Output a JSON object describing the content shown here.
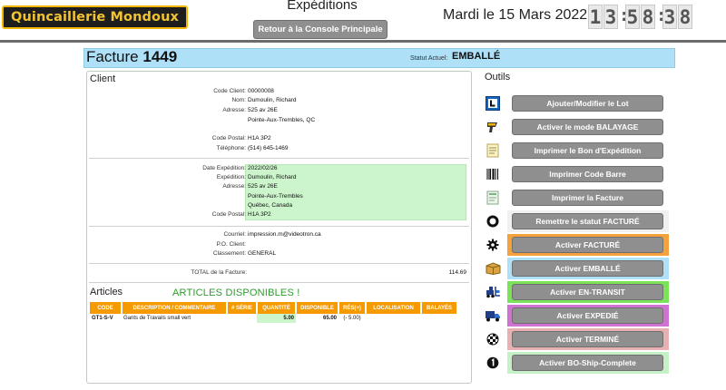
{
  "header": {
    "brand": "Quincaillerie Mondoux",
    "page_title": "Expéditions",
    "console_button": "Retour à la Console Principale",
    "date": "Mardi le 15 Mars 2022",
    "clock": {
      "h1": "1",
      "h2": "3",
      "m1": "5",
      "m2": "8",
      "s1": "3",
      "s2": "8",
      "sep": ":"
    }
  },
  "invoice": {
    "label": "Facture",
    "number": "1449",
    "status_label": "Statut Actuel:",
    "status_value": "EMBALLÉ"
  },
  "client": {
    "section_title": "Client",
    "code_label": "Code Client:",
    "code": "00000008",
    "name_label": "Nom:",
    "name": "Dumoulin, Richard",
    "address_label": "Adresse:",
    "address1": "525 av 26E",
    "address2": "Pointe-Aux-Trembles, QC",
    "postal_label": "Code Postal:",
    "postal": "H1A 3P2",
    "phone_label": "Téléphone:",
    "phone": "(514) 645-1469"
  },
  "shipping": {
    "date_label": "Date Expédition:",
    "date": "2022/02/26",
    "to_label": "Expédition:",
    "to": "Dumoulin, Richard",
    "address_label": "Adresse:",
    "address1": "525 av 26E",
    "address2": "Pointe-Aux-Trembles",
    "address3": "Québec, Canada",
    "postal_label": "Code Postal:",
    "postal": "H1A 3P2"
  },
  "extra": {
    "email_label": "Courriel:",
    "email": "impression.m@videotron.ca",
    "po_label": "P.O. Client:",
    "po": "",
    "class_label": "Classement:",
    "class": "GENERAL",
    "total_label": "TOTAL de la Facture:",
    "total": "114.69"
  },
  "articles": {
    "title": "Articles",
    "status": "ARTICLES DISPONIBLES !",
    "columns": [
      "CODE",
      "DESCRIPTION / COMMENTAIRE",
      "# SÉRIE",
      "QUANTITÉ",
      "DISPONIBLE",
      "RÉS(+)",
      "LOCALISATION",
      "BALAYÉS"
    ],
    "rows": [
      {
        "code": "GT1-S-V",
        "description": "Gants de Travails small vert",
        "serial": "",
        "quantity": "5.00",
        "available": "65.00",
        "reserved": "(- 5.00)",
        "location": "",
        "scanned": ""
      }
    ]
  },
  "tools": {
    "title": "Outils",
    "buttons": [
      {
        "label": "Ajouter/Modifier le Lot",
        "icon": "lot-icon",
        "highlight": ""
      },
      {
        "label": "Activer le mode BALAYAGE",
        "icon": "scanner-icon",
        "highlight": ""
      },
      {
        "label": "Imprimer le Bon d'Expédition",
        "icon": "document-icon",
        "highlight": ""
      },
      {
        "label": "Imprimer Code Barre",
        "icon": "barcode-icon",
        "highlight": ""
      },
      {
        "label": "Imprimer la Facture",
        "icon": "invoice-icon",
        "highlight": ""
      },
      {
        "label": "Remettre le statut FACTURÉ",
        "icon": "reset-ring-icon",
        "highlight": "#f1f1f1"
      },
      {
        "label": "Activer FACTURÉ",
        "icon": "gear-icon",
        "highlight": "#f5a23c"
      },
      {
        "label": "Activer EMBALLÉ",
        "icon": "package-icon",
        "highlight": "#aee0f8"
      },
      {
        "label": "Activer EN-TRANSIT",
        "icon": "forklift-icon",
        "highlight": "#7be35a"
      },
      {
        "label": "Activer EXPEDIÉ",
        "icon": "truck-icon",
        "highlight": "#cf72d2"
      },
      {
        "label": "Activer TERMINÉ",
        "icon": "checkered-flag-icon",
        "highlight": "#e8b0b0"
      },
      {
        "label": "Activer BO-Ship-Complete",
        "icon": "number-one-icon",
        "highlight": "#c6f0c6"
      }
    ]
  },
  "colors": {
    "brand_bg": "#1e1e1e",
    "brand_text": "#f2c230",
    "invoice_header_bg": "#aee0f8",
    "shipping_bg": "#ccf5cc",
    "table_header_bg": "#f59a00",
    "available_text": "#1a3fbd",
    "articles_status": "#2f9a2f",
    "button_gray": "#8f8f8f"
  }
}
